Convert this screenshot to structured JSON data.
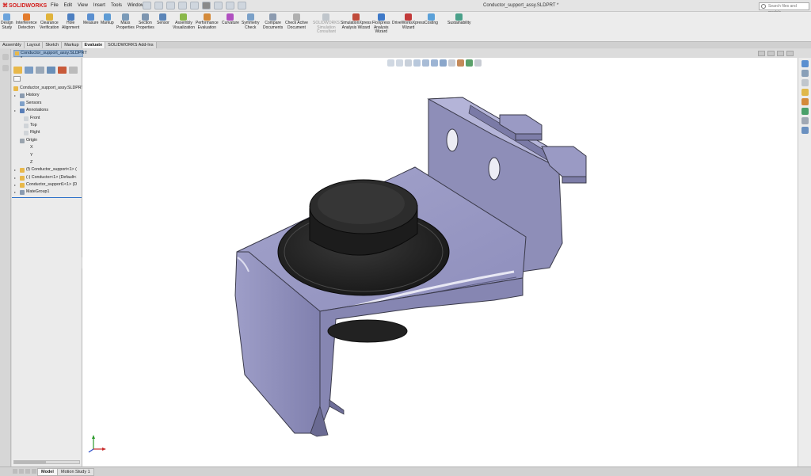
{
  "app": {
    "logo_text": "SOLIDWORKS",
    "document_title": "Conductor_support_assy.SLDPRT *",
    "search_placeholder": "Search files and models"
  },
  "menu": [
    "File",
    "Edit",
    "View",
    "Insert",
    "Tools",
    "Window"
  ],
  "commands": [
    {
      "label1": "Design",
      "label2": "Study",
      "label3": "",
      "icon_color": "#6aa3dc",
      "enabled": true
    },
    {
      "label1": "Interference",
      "label2": "Detection",
      "label3": "",
      "icon_color": "#e37b2c",
      "enabled": true
    },
    {
      "label1": "Clearance",
      "label2": "Verification",
      "label3": "",
      "icon_color": "#e0b33b",
      "enabled": true
    },
    {
      "label1": "Hole",
      "label2": "Alignment",
      "label3": "",
      "icon_color": "#4c7fc1",
      "enabled": true
    },
    {
      "label1": "Measure",
      "label2": "",
      "label3": "",
      "icon_color": "#5a8fd0",
      "enabled": true
    },
    {
      "label1": "Markup",
      "label2": "",
      "label3": "",
      "icon_color": "#5d9bd4",
      "enabled": true
    },
    {
      "label1": "Mass",
      "label2": "Properties",
      "label3": "",
      "icon_color": "#7a9ab8",
      "enabled": true
    },
    {
      "label1": "Section",
      "label2": "Properties",
      "label3": "",
      "icon_color": "#7d95b0",
      "enabled": true
    },
    {
      "label1": "Sensor",
      "label2": "",
      "label3": "",
      "icon_color": "#5b85b8",
      "enabled": true
    },
    {
      "label1": "Assembly",
      "label2": "Visualization",
      "label3": "",
      "icon_color": "#8ab84a",
      "enabled": true
    },
    {
      "label1": "Performance",
      "label2": "Evaluation",
      "label3": "",
      "icon_color": "#d48a3a",
      "enabled": true
    },
    {
      "label1": "Curvature",
      "label2": "",
      "label3": "",
      "icon_color": "#b050c0",
      "enabled": true
    },
    {
      "label1": "Symmetry",
      "label2": "Check",
      "label3": "",
      "icon_color": "#7aa0c8",
      "enabled": true
    },
    {
      "label1": "Compare",
      "label2": "Documents",
      "label3": "",
      "icon_color": "#8c9bb0",
      "enabled": true
    },
    {
      "label1": "Check Active",
      "label2": "Document",
      "label3": "",
      "icon_color": "#b0b0b0",
      "enabled": true
    },
    {
      "label1": "SOLIDWORKS",
      "label2": "Simulation",
      "label3": "Consultant",
      "icon_color": "#c0c6cc",
      "enabled": false
    },
    {
      "label1": "SimulationXpress",
      "label2": "Analysis Wizard",
      "label3": "",
      "icon_color": "#c04a3a",
      "enabled": true
    },
    {
      "label1": "FloXpress",
      "label2": "Analysis",
      "label3": "Wizard",
      "icon_color": "#3e79c8",
      "enabled": true
    },
    {
      "label1": "DriveWorksXpress",
      "label2": "Wizard",
      "label3": "",
      "icon_color": "#c23a3a",
      "enabled": true
    },
    {
      "label1": "Costing",
      "label2": "",
      "label3": "",
      "icon_color": "#5aa0d8",
      "enabled": true
    },
    {
      "label1": "Sustainability",
      "label2": "",
      "label3": "",
      "icon_color": "#4aa08a",
      "enabled": true
    }
  ],
  "tabs": [
    {
      "label": "Assembly",
      "active": false
    },
    {
      "label": "Layout",
      "active": false
    },
    {
      "label": "Sketch",
      "active": false
    },
    {
      "label": "Markup",
      "active": false
    },
    {
      "label": "Evaluate",
      "active": true
    },
    {
      "label": "SOLIDWORKS Add-Ins",
      "active": false
    }
  ],
  "doc_tab_label": "Conductor_support_assy.SLDPRT *",
  "tree": [
    {
      "label": "Conductor_support_assy.SLDPRT",
      "indent": 0,
      "expand": "",
      "icon": "#e8b84a"
    },
    {
      "label": "History",
      "indent": 1,
      "expand": "▸",
      "icon": "#8a9bb0"
    },
    {
      "label": "Sensors",
      "indent": 1,
      "expand": "",
      "icon": "#7fa0c8"
    },
    {
      "label": "Annotations",
      "indent": 1,
      "expand": "▸",
      "icon": "#5a7fb8"
    },
    {
      "label": "Front",
      "indent": 2,
      "expand": "",
      "icon": "#d0d4d8"
    },
    {
      "label": "Top",
      "indent": 2,
      "expand": "",
      "icon": "#d0d4d8"
    },
    {
      "label": "Right",
      "indent": 2,
      "expand": "",
      "icon": "#d0d4d8"
    },
    {
      "label": "Origin",
      "indent": 1,
      "expand": "",
      "icon": "#9aa4ae"
    },
    {
      "label": "X",
      "indent": 2,
      "expand": "",
      "icon": ""
    },
    {
      "label": "Y",
      "indent": 2,
      "expand": "",
      "icon": ""
    },
    {
      "label": "Z",
      "indent": 2,
      "expand": "",
      "icon": ""
    },
    {
      "label": "(f) Conductor_support<1> (",
      "indent": 1,
      "expand": "▸",
      "icon": "#e8b84a"
    },
    {
      "label": "(-) Conductor<1> (Default<",
      "indent": 1,
      "expand": "▸",
      "icon": "#e8b84a"
    },
    {
      "label": "Conductor_support1<1> (D",
      "indent": 1,
      "expand": "▸",
      "icon": "#e8b84a"
    },
    {
      "label": "MateGroup1",
      "indent": 1,
      "expand": "▸",
      "icon": "#8a9bb0"
    }
  ],
  "bottom_tabs": [
    {
      "label": "Model",
      "active": true
    },
    {
      "label": "Motion Study 1",
      "active": false
    }
  ],
  "colors": {
    "part_body": "#9c9cc8",
    "part_dark": "#7a7aa8",
    "part_edge": "#3a3a4a",
    "conductor": "#2a2a2a",
    "accent_blue": "#2a6fc9"
  }
}
